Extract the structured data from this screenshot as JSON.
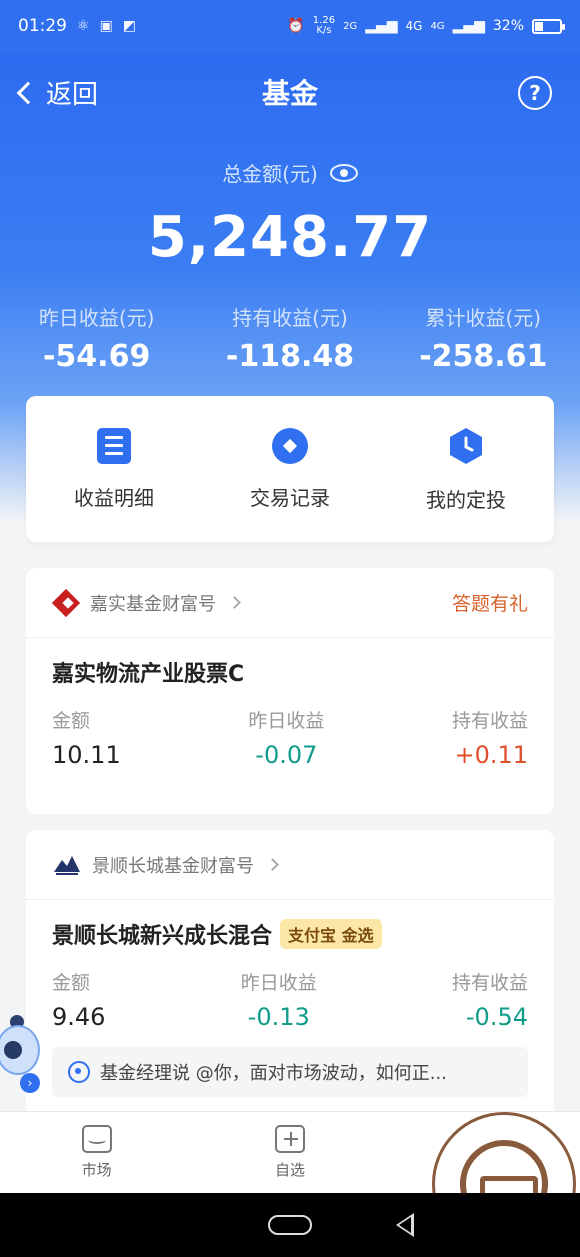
{
  "status_bar": {
    "time": "01:29",
    "net_speed": "1.26\nK/s",
    "signal_2g": "2G",
    "signal_4g_a": "4G",
    "signal_4g_b": "4G",
    "battery": "32%",
    "battery_level": 0.32
  },
  "nav": {
    "back_label": "返回",
    "title": "基金",
    "help_glyph": "?"
  },
  "summary": {
    "total_label": "总金额(元)",
    "total_value": "5,248.77",
    "stats": [
      {
        "label": "昨日收益(元)",
        "value": "-54.69"
      },
      {
        "label": "持有收益(元)",
        "value": "-118.48"
      },
      {
        "label": "累计收益(元)",
        "value": "-258.61"
      }
    ]
  },
  "actions": [
    {
      "label": "收益明细",
      "icon": "document-icon"
    },
    {
      "label": "交易记录",
      "icon": "record-icon"
    },
    {
      "label": "我的定投",
      "icon": "clock-shield-icon"
    }
  ],
  "cards": [
    {
      "brand": "嘉实基金财富号",
      "promo": "答题有礼",
      "fund_name": "嘉实物流产业股票C",
      "amount_label": "金额",
      "amount": "10.11",
      "yesterday_label": "昨日收益",
      "yesterday": "-0.07",
      "holding_label": "持有收益",
      "holding": "+0.11"
    },
    {
      "brand": "景顺长城基金财富号",
      "fund_name": "景顺长城新兴成长混合",
      "tag": "支付宝 金选",
      "amount_label": "金额",
      "amount": "9.46",
      "yesterday_label": "昨日收益",
      "yesterday": "-0.13",
      "holding_label": "持有收益",
      "holding": "-0.54",
      "manager_text": "基金经理说 @你，面对市场波动，如何正..."
    }
  ],
  "tabbar": [
    {
      "label": "市场",
      "icon": "market-icon"
    },
    {
      "label": "自选",
      "icon": "watchlist-icon"
    }
  ],
  "colors": {
    "primary": "#2f6ff0",
    "positive": "#e04f2c",
    "negative": "#119c8a",
    "promo": "#d8622b"
  }
}
